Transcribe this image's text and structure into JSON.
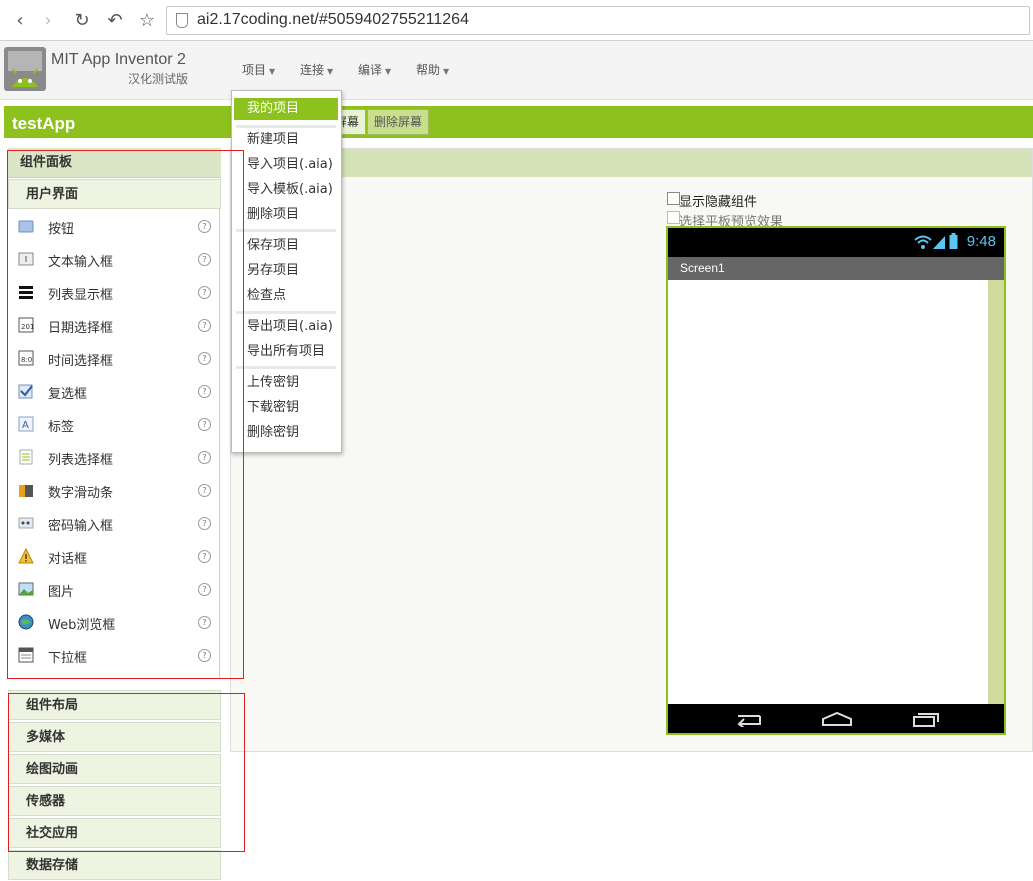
{
  "browser": {
    "url": "ai2.17coding.net/#5059402755211264"
  },
  "header": {
    "title": "MIT App Inventor 2",
    "subtitle": "汉化测试版",
    "menus": [
      "项目",
      "连接",
      "编译",
      "帮助"
    ]
  },
  "project": {
    "name": "testApp",
    "screen_buttons": [
      "屏幕",
      "删除屏幕"
    ]
  },
  "dropdown": {
    "items": [
      "我的项目",
      "新建项目",
      "导入项目(.aia)",
      "导入模板(.aia)",
      "删除项目",
      "保存项目",
      "另存项目",
      "检查点",
      "导出项目(.aia)",
      "导出所有项目",
      "上传密钥",
      "下载密钥",
      "删除密钥"
    ]
  },
  "palette": {
    "title": "组件面板",
    "ui_category": "用户界面",
    "items": [
      {
        "label": "按钮",
        "icon": "button-icon"
      },
      {
        "label": "文本输入框",
        "icon": "textbox-icon"
      },
      {
        "label": "列表显示框",
        "icon": "listview-icon"
      },
      {
        "label": "日期选择框",
        "icon": "datepicker-icon"
      },
      {
        "label": "时间选择框",
        "icon": "timepicker-icon"
      },
      {
        "label": "复选框",
        "icon": "checkbox-icon"
      },
      {
        "label": "标签",
        "icon": "label-icon"
      },
      {
        "label": "列表选择框",
        "icon": "listpicker-icon"
      },
      {
        "label": "数字滑动条",
        "icon": "slider-icon"
      },
      {
        "label": "密码输入框",
        "icon": "password-icon"
      },
      {
        "label": "对话框",
        "icon": "notifier-icon"
      },
      {
        "label": "图片",
        "icon": "image-icon"
      },
      {
        "label": "Web浏览框",
        "icon": "webviewer-icon"
      },
      {
        "label": "下拉框",
        "icon": "spinner-icon"
      }
    ],
    "categories": [
      "组件布局",
      "多媒体",
      "绘图动画",
      "传感器",
      "社交应用",
      "数据存储"
    ]
  },
  "viewer": {
    "show_hidden": "显示隐藏组件",
    "tablet_preview": "选择平板预览效果",
    "phone_time": "9:48",
    "screen_title": "Screen1"
  },
  "colors": {
    "accent": "#8dc11e",
    "annotation": "#e02020"
  }
}
